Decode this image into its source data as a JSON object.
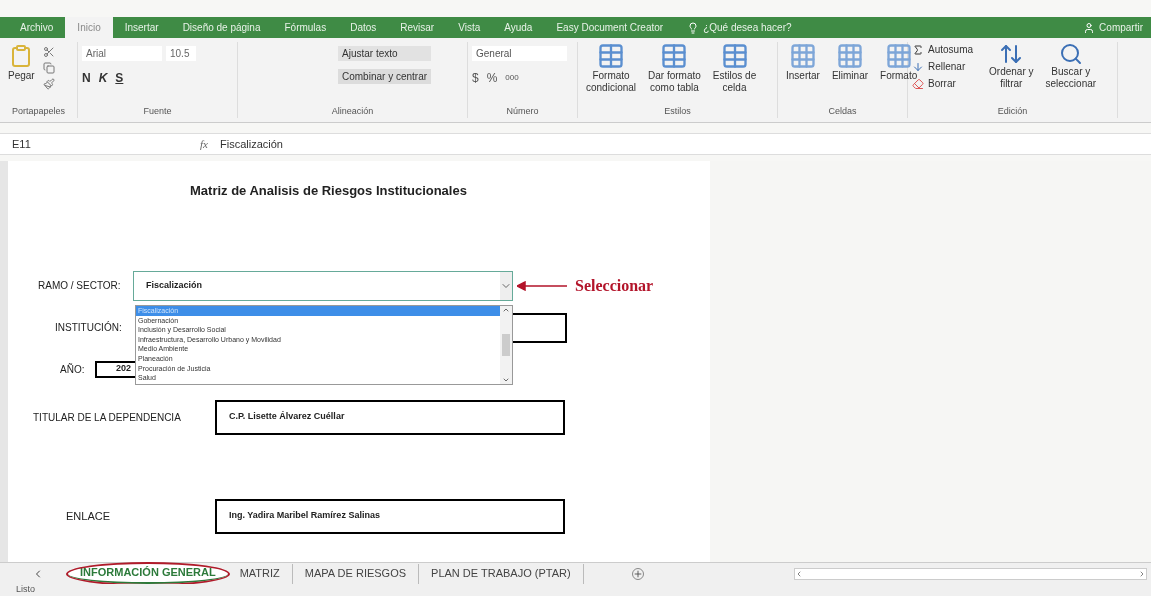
{
  "menu_tabs": [
    {
      "label": "Archivo",
      "selected": false
    },
    {
      "label": "Inicio",
      "selected": true
    },
    {
      "label": "Insertar",
      "selected": false
    },
    {
      "label": "Diseño de página",
      "selected": false
    },
    {
      "label": "Fórmulas",
      "selected": false
    },
    {
      "label": "Datos",
      "selected": false
    },
    {
      "label": "Revisar",
      "selected": false
    },
    {
      "label": "Vista",
      "selected": false
    },
    {
      "label": "Ayuda",
      "selected": false
    },
    {
      "label": "Easy Document Creator",
      "selected": false
    }
  ],
  "tell_me": "¿Qué desea hacer?",
  "share": "Compartir",
  "ribbon": {
    "clipboard": {
      "paste": "Pegar",
      "label": "Portapapeles"
    },
    "font": {
      "name": "Arial",
      "size": "10.5",
      "styles": [
        "N",
        "K",
        "S"
      ],
      "label": "Fuente"
    },
    "alignment": {
      "wrap": "Ajustar texto",
      "merge": "Combinar y centrar",
      "label": "Alineación"
    },
    "number": {
      "format": "General",
      "symbols": [
        "$",
        "%",
        "000"
      ],
      "label": "Número"
    },
    "styles": {
      "items": [
        [
          "Formato",
          "condicional"
        ],
        [
          "Dar formato",
          "como tabla"
        ],
        [
          "Estilos de",
          "celda"
        ]
      ],
      "label": "Estilos"
    },
    "cells": {
      "items": [
        "Insertar",
        "Eliminar",
        "Formato"
      ],
      "label": "Celdas"
    },
    "editing": {
      "small": [
        "Autosuma",
        "Rellenar",
        "Borrar"
      ],
      "big": [
        [
          "Ordenar y",
          "filtrar"
        ],
        [
          "Buscar y",
          "seleccionar"
        ]
      ],
      "label": "Edición"
    }
  },
  "formula_bar": {
    "cell": "E11",
    "fx": "fx",
    "value": "Fiscalización"
  },
  "form": {
    "title": "Matriz de Analisis de Riesgos Institucionales",
    "ramo": {
      "label": "RAMO / SECTOR:",
      "value": "Fiscalización"
    },
    "options": [
      {
        "label": "Fiscalización",
        "selected": true
      },
      {
        "label": "Gobernación",
        "selected": false
      },
      {
        "label": "Inclusión y Desarrollo Social",
        "selected": false
      },
      {
        "label": "Infraestructura, Desarrollo Urbano y Movilidad",
        "selected": false
      },
      {
        "label": "Medio Ambiente",
        "selected": false
      },
      {
        "label": "Planeación",
        "selected": false
      },
      {
        "label": "Procuración de Justicia",
        "selected": false
      },
      {
        "label": "Salud",
        "selected": false
      }
    ],
    "institucion": {
      "label": "INSTITUCIÓN:"
    },
    "anio": {
      "label": "AÑO:",
      "value": "202"
    },
    "titular": {
      "label": "TITULAR DE LA DEPENDENCIA",
      "value": "C.P. Lisette Álvarez Cuéllar"
    },
    "enlace": {
      "label": "ENLACE",
      "value": "Ing. Yadira Maribel Ramírez Salinas"
    }
  },
  "annotation": "Seleccionar",
  "sheet_tabs": [
    {
      "label": "INFORMACIÓN GENERAL",
      "selected": true
    },
    {
      "label": "MATRIZ",
      "selected": false
    },
    {
      "label": "MAPA DE RIESGOS",
      "selected": false
    },
    {
      "label": "PLAN DE TRABAJO (PTAR)",
      "selected": false
    }
  ],
  "status": "Listo"
}
